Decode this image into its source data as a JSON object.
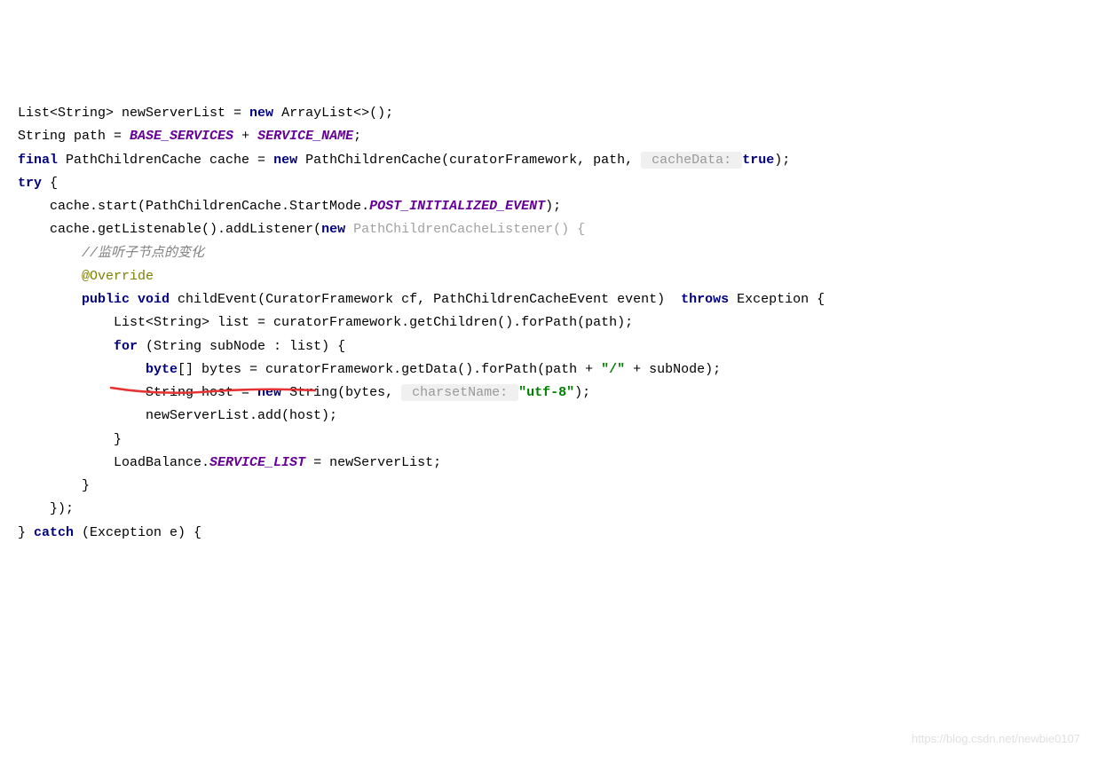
{
  "code": {
    "l1_p1": "List<String> newServerList = ",
    "l1_new": "new",
    "l1_p2": " ArrayList<>();",
    "l2_p1": "String path = ",
    "l2_c1": "BASE_SERVICES",
    "l2_p2": " + ",
    "l2_c2": "SERVICE_NAME",
    "l2_p3": ";",
    "l3_final": "final",
    "l3_p1": " PathChildrenCache cache = ",
    "l3_new": "new",
    "l3_p2": " PathChildrenCache(curatorFramework, path, ",
    "l3_hint": " cacheData: ",
    "l3_true": "true",
    "l3_p3": ");",
    "l4_try": "try",
    "l4_p1": " {",
    "l5_p1": "    cache.start(PathChildrenCache.StartMode.",
    "l5_c": "POST_INITIALIZED_EVENT",
    "l5_p2": ");",
    "l6_p1": "    cache.getListenable().addListener(",
    "l6_new": "new",
    "l6_light": " PathChildrenCacheListener() {",
    "l7_comment": "        //监听子节点的变化",
    "l8_anno": "        @Override",
    "l9_pub": "        public",
    "l9_void": " void",
    "l9_p1": " childEvent(CuratorFramework cf, PathChildrenCacheEvent event) ",
    "l9_throws": " throws",
    "l9_p2": " Exception {",
    "l10_p1": "            List<String> list = curatorFramework.getChildren().forPath(path);",
    "l11_for": "            for",
    "l11_p1": " (String subNode : list) {",
    "l12_byte": "                byte",
    "l12_p1": "[] bytes = curatorFramework.getData().forPath(path + ",
    "l12_str": "\"/\"",
    "l12_p2": " + subNode);",
    "l13_p1": "                String host = ",
    "l13_new": "new",
    "l13_p2": " String(bytes, ",
    "l13_hint": " charsetName: ",
    "l13_str": "\"utf-8\"",
    "l13_p3": ");",
    "l14_p1": "                newServerList.add(host);",
    "l15_p1": "            }",
    "l16_p1": "            LoadBalance.",
    "l16_c": "SERVICE_LIST",
    "l16_p2": " = newServerList;",
    "l17_p1": "        }",
    "l18_p1": "    });",
    "l19_p1": "} ",
    "l19_catch": "catch",
    "l19_p2": " (Exception e) {"
  },
  "watermark": "https://blog.csdn.net/newbie0107"
}
